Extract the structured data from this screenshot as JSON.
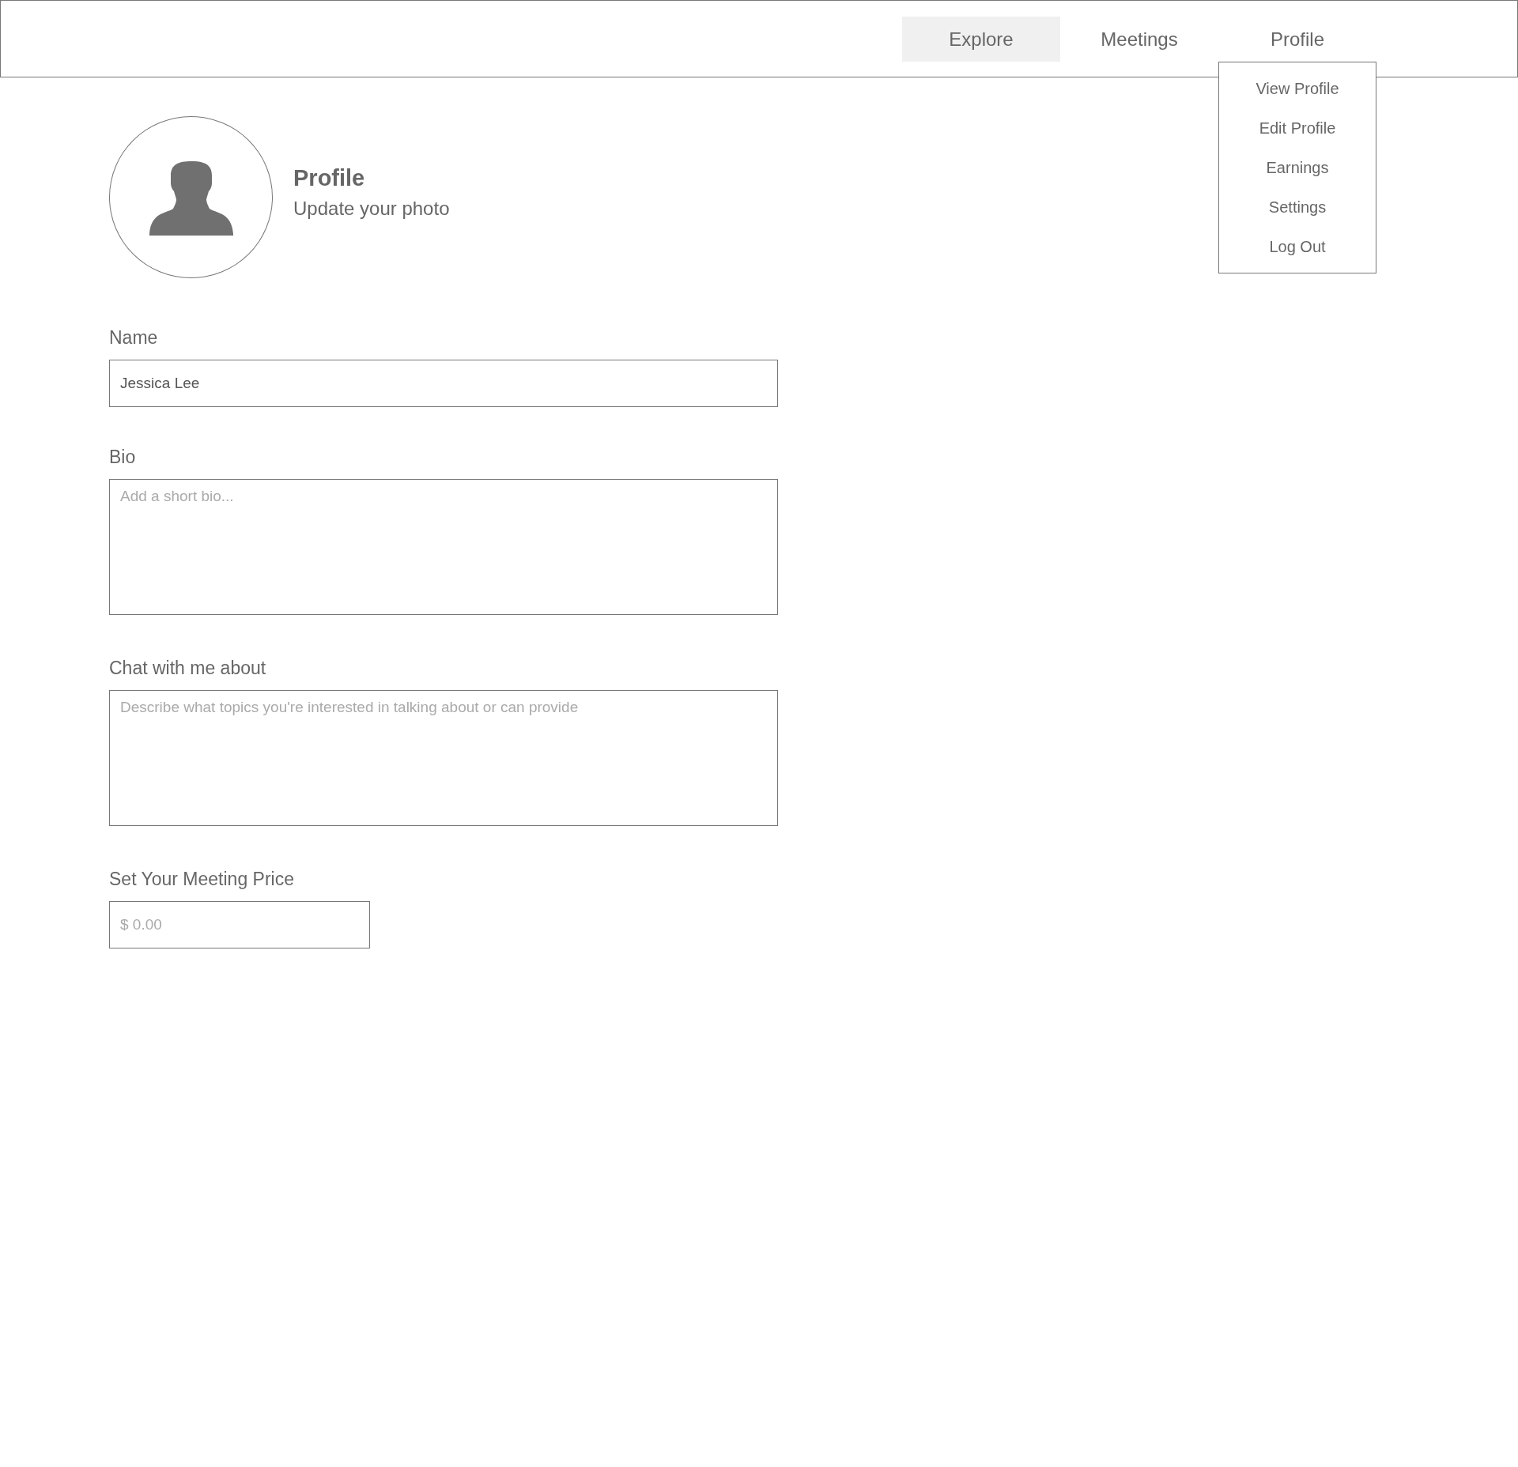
{
  "nav": {
    "tabs": [
      {
        "label": "Explore",
        "selected": true
      },
      {
        "label": "Meetings",
        "selected": false
      },
      {
        "label": "Profile",
        "selected": false
      }
    ]
  },
  "profile_menu": {
    "open": true,
    "items": [
      "View Profile",
      "Edit Profile",
      "Earnings",
      "Settings",
      "Log Out"
    ]
  },
  "header": {
    "title": "Profile",
    "subtitle": "Update your photo"
  },
  "form": {
    "fields": [
      {
        "kind": "input",
        "label": "Name",
        "value": "Jessica Lee"
      },
      {
        "kind": "textarea",
        "label": "Bio",
        "placeholder": "Add a short bio..."
      },
      {
        "kind": "textarea",
        "label": "Chat with me about",
        "placeholder": "Describe what topics you're interested in talking about or can provide"
      },
      {
        "kind": "price",
        "label": "Set Your Meeting Price",
        "placeholder": "$ 0.00"
      }
    ]
  }
}
